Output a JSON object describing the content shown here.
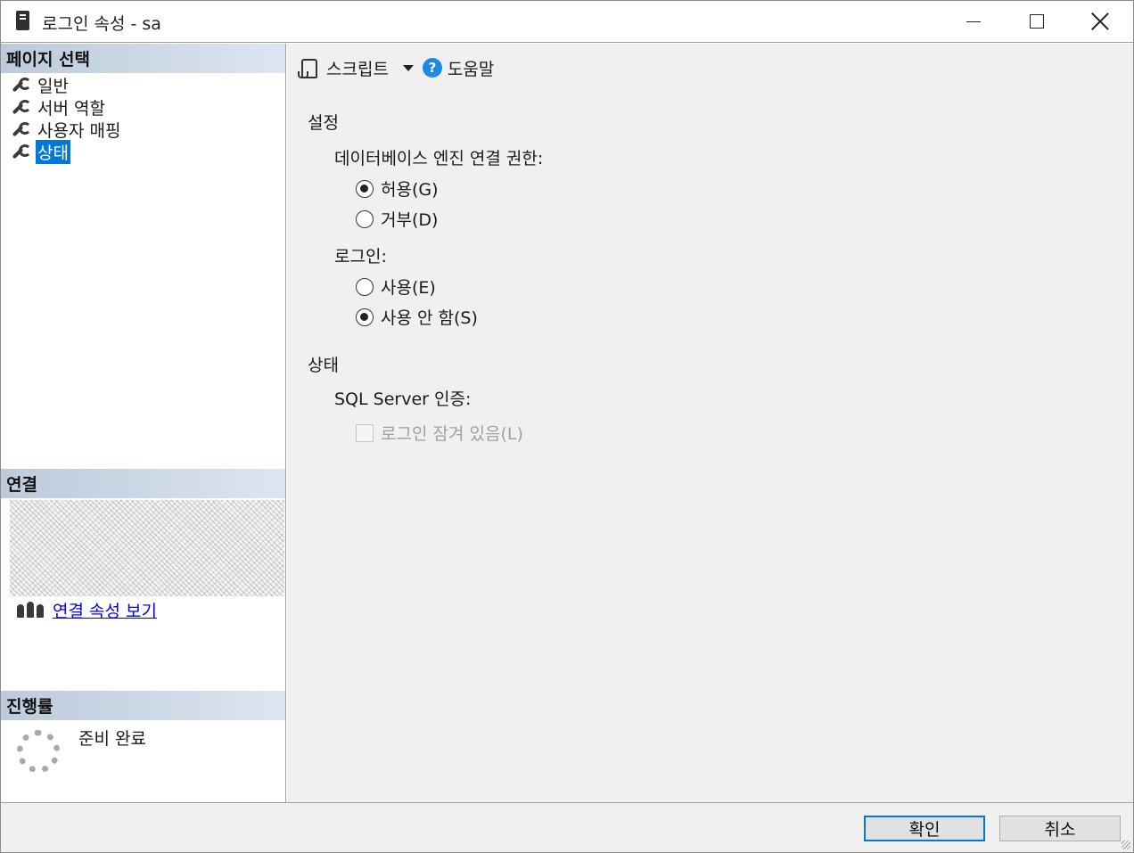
{
  "window": {
    "title": "로그인 속성 - sa",
    "icons": {
      "app": "server-icon",
      "min": "minimize-icon",
      "max": "maximize-icon",
      "close": "close-icon"
    }
  },
  "left": {
    "pages_header": "페이지 선택",
    "pages": [
      {
        "label": "일반",
        "selected": false
      },
      {
        "label": "서버 역할",
        "selected": false
      },
      {
        "label": "사용자 매핑",
        "selected": false
      },
      {
        "label": "상태",
        "selected": true
      }
    ],
    "connection_header": "연결",
    "connection_link": "연결 속성 보기",
    "progress_header": "진행률",
    "progress_text": "준비 완료"
  },
  "toolbar": {
    "script_label": "스크립트",
    "help_label": "도움말"
  },
  "settings": {
    "title": "설정",
    "db_access_label": "데이터베이스 엔진 연결 권한:",
    "grant_label": "허용(G)",
    "deny_label": "거부(D)",
    "login_label": "로그인:",
    "enabled_label": "사용(E)",
    "disabled_label": "사용 안 함(S)",
    "grant_selected": true,
    "login_disabled_selected": true
  },
  "status": {
    "title": "상태",
    "sql_auth_label": "SQL Server 인증:",
    "locked_label": "로그인 잠겨 있음(L)",
    "locked_checked": false
  },
  "footer": {
    "ok_label": "확인",
    "cancel_label": "취소"
  },
  "colors": {
    "accent": "#0078d7",
    "header_gradient_start": "#bccadb",
    "link": "#0000ee"
  }
}
